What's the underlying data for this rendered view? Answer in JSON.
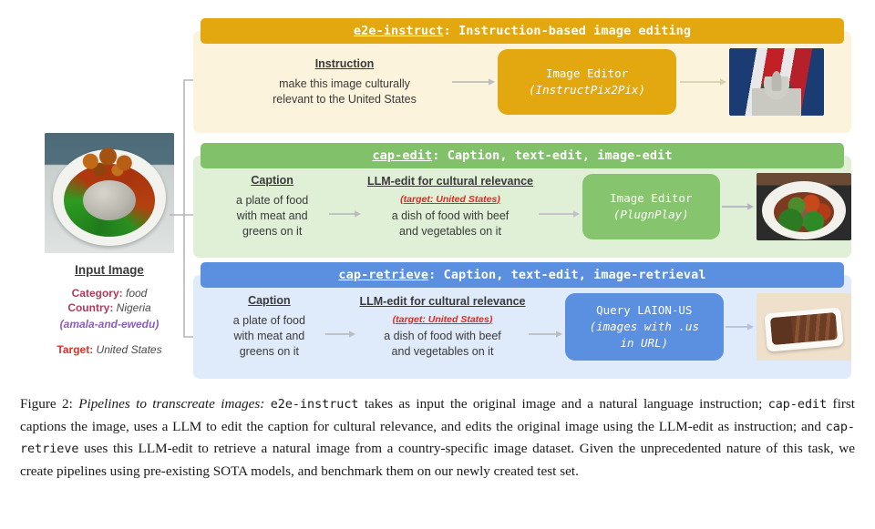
{
  "figure": {
    "input": {
      "title": "Input Image",
      "image_alt": "amala-and-ewedu-plate",
      "category_key": "Category",
      "category_value": "food",
      "country_key": "Country",
      "country_value": "Nigeria",
      "native_name": "(amala-and-ewedu)",
      "target_key": "Target",
      "target_value": "United States"
    },
    "pipelines": [
      {
        "id": "e2e-instruct",
        "tag": "e2e-instruct",
        "header_rest": ": Instruction-based image editing",
        "accent": "#e3a70f",
        "body_bg": "#fcf3dc",
        "input_head": "Instruction",
        "input_text_lines": [
          "make this image culturally",
          "relevant to the United States"
        ],
        "model_title": "Image Editor",
        "model_sub": "(InstructPix2Pix)",
        "result_alt": "us-capitol-flag-collage"
      },
      {
        "id": "cap-edit",
        "tag": "cap-edit",
        "header_rest": ": Caption, text-edit, image-edit",
        "accent": "#81c169",
        "body_bg": "#dff0d7",
        "caption_head": "Caption",
        "caption_lines": [
          "a plate of food",
          "with meat and",
          "greens on it"
        ],
        "edit_head": "LLM-edit for cultural relevance",
        "edit_target_note": "(target: United States)",
        "edit_lines": [
          "a dish of food with beef",
          "and vegetables on it"
        ],
        "model_title": "Image Editor",
        "model_sub": "(PlugnPlay)",
        "result_alt": "beef-and-vegetables-plate"
      },
      {
        "id": "cap-retrieve",
        "tag": "cap-retrieve",
        "header_rest": ": Caption, text-edit, image-retrieval",
        "accent": "#5b8fe0",
        "body_bg": "#dfeafb",
        "caption_head": "Caption",
        "caption_lines": [
          "a plate of food",
          "with meat and",
          "greens on it"
        ],
        "edit_head": "LLM-edit for cultural relevance",
        "edit_target_note": "(target: United States)",
        "edit_lines": [
          "a dish of food with beef",
          "and vegetables on it"
        ],
        "model_title": "Query LAION-US",
        "model_sub_lines": [
          "(images with .us",
          "in URL)"
        ],
        "result_alt": "steak-strips-with-peppers"
      }
    ],
    "caption": {
      "label": "Figure 2:",
      "lead_italic": "Pipelines to transcreate images:",
      "mono1": "e2e-instruct",
      "seg1": " takes as input the original image and a natural language instruction; ",
      "mono2": "cap-edit",
      "seg2": " first captions the image, uses a LLM to edit the caption for cultural relevance, and edits the original image using the LLM-edit as instruction; and ",
      "mono3": "cap-retrieve",
      "seg3": " uses this LLM-edit to retrieve a natural image from a country-specific image dataset. Given the unprecedented nature of this task, we create pipelines using pre-existing SOTA models, and benchmark them on our newly created test set."
    }
  }
}
